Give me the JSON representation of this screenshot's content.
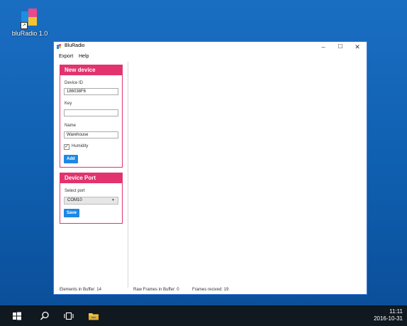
{
  "desktop": {
    "icon_label": "bluRadio 1.0"
  },
  "window": {
    "title": "BluRadio",
    "controls": {
      "minimize": "–",
      "maximize": "☐",
      "close": "✕"
    }
  },
  "menu": {
    "items": [
      "Export",
      "Help"
    ]
  },
  "new_device": {
    "header": "New device",
    "device_id_label": "Device ID",
    "device_id_value": "186038F6",
    "key_label": "Key",
    "key_value": "",
    "name_label": "Name",
    "name_value": "Warehouse",
    "humidity_label": "Humidity",
    "humidity_checked": "✓",
    "add_label": "Add"
  },
  "device_port": {
    "header": "Device Port",
    "select_label": "Select port",
    "port_value": "COM10",
    "save_label": "Save"
  },
  "status": {
    "elements": "Elements in Buffer: 14",
    "raw_frames": "Raw Frames in Buffer: 0",
    "frames_received": "Frames recived: 19"
  },
  "taskbar": {
    "time": "11:11",
    "date": "2016-10-31"
  },
  "colors": {
    "accent": "#e2336f",
    "button": "#1e88e5",
    "desktop": "#0f5fb0"
  }
}
